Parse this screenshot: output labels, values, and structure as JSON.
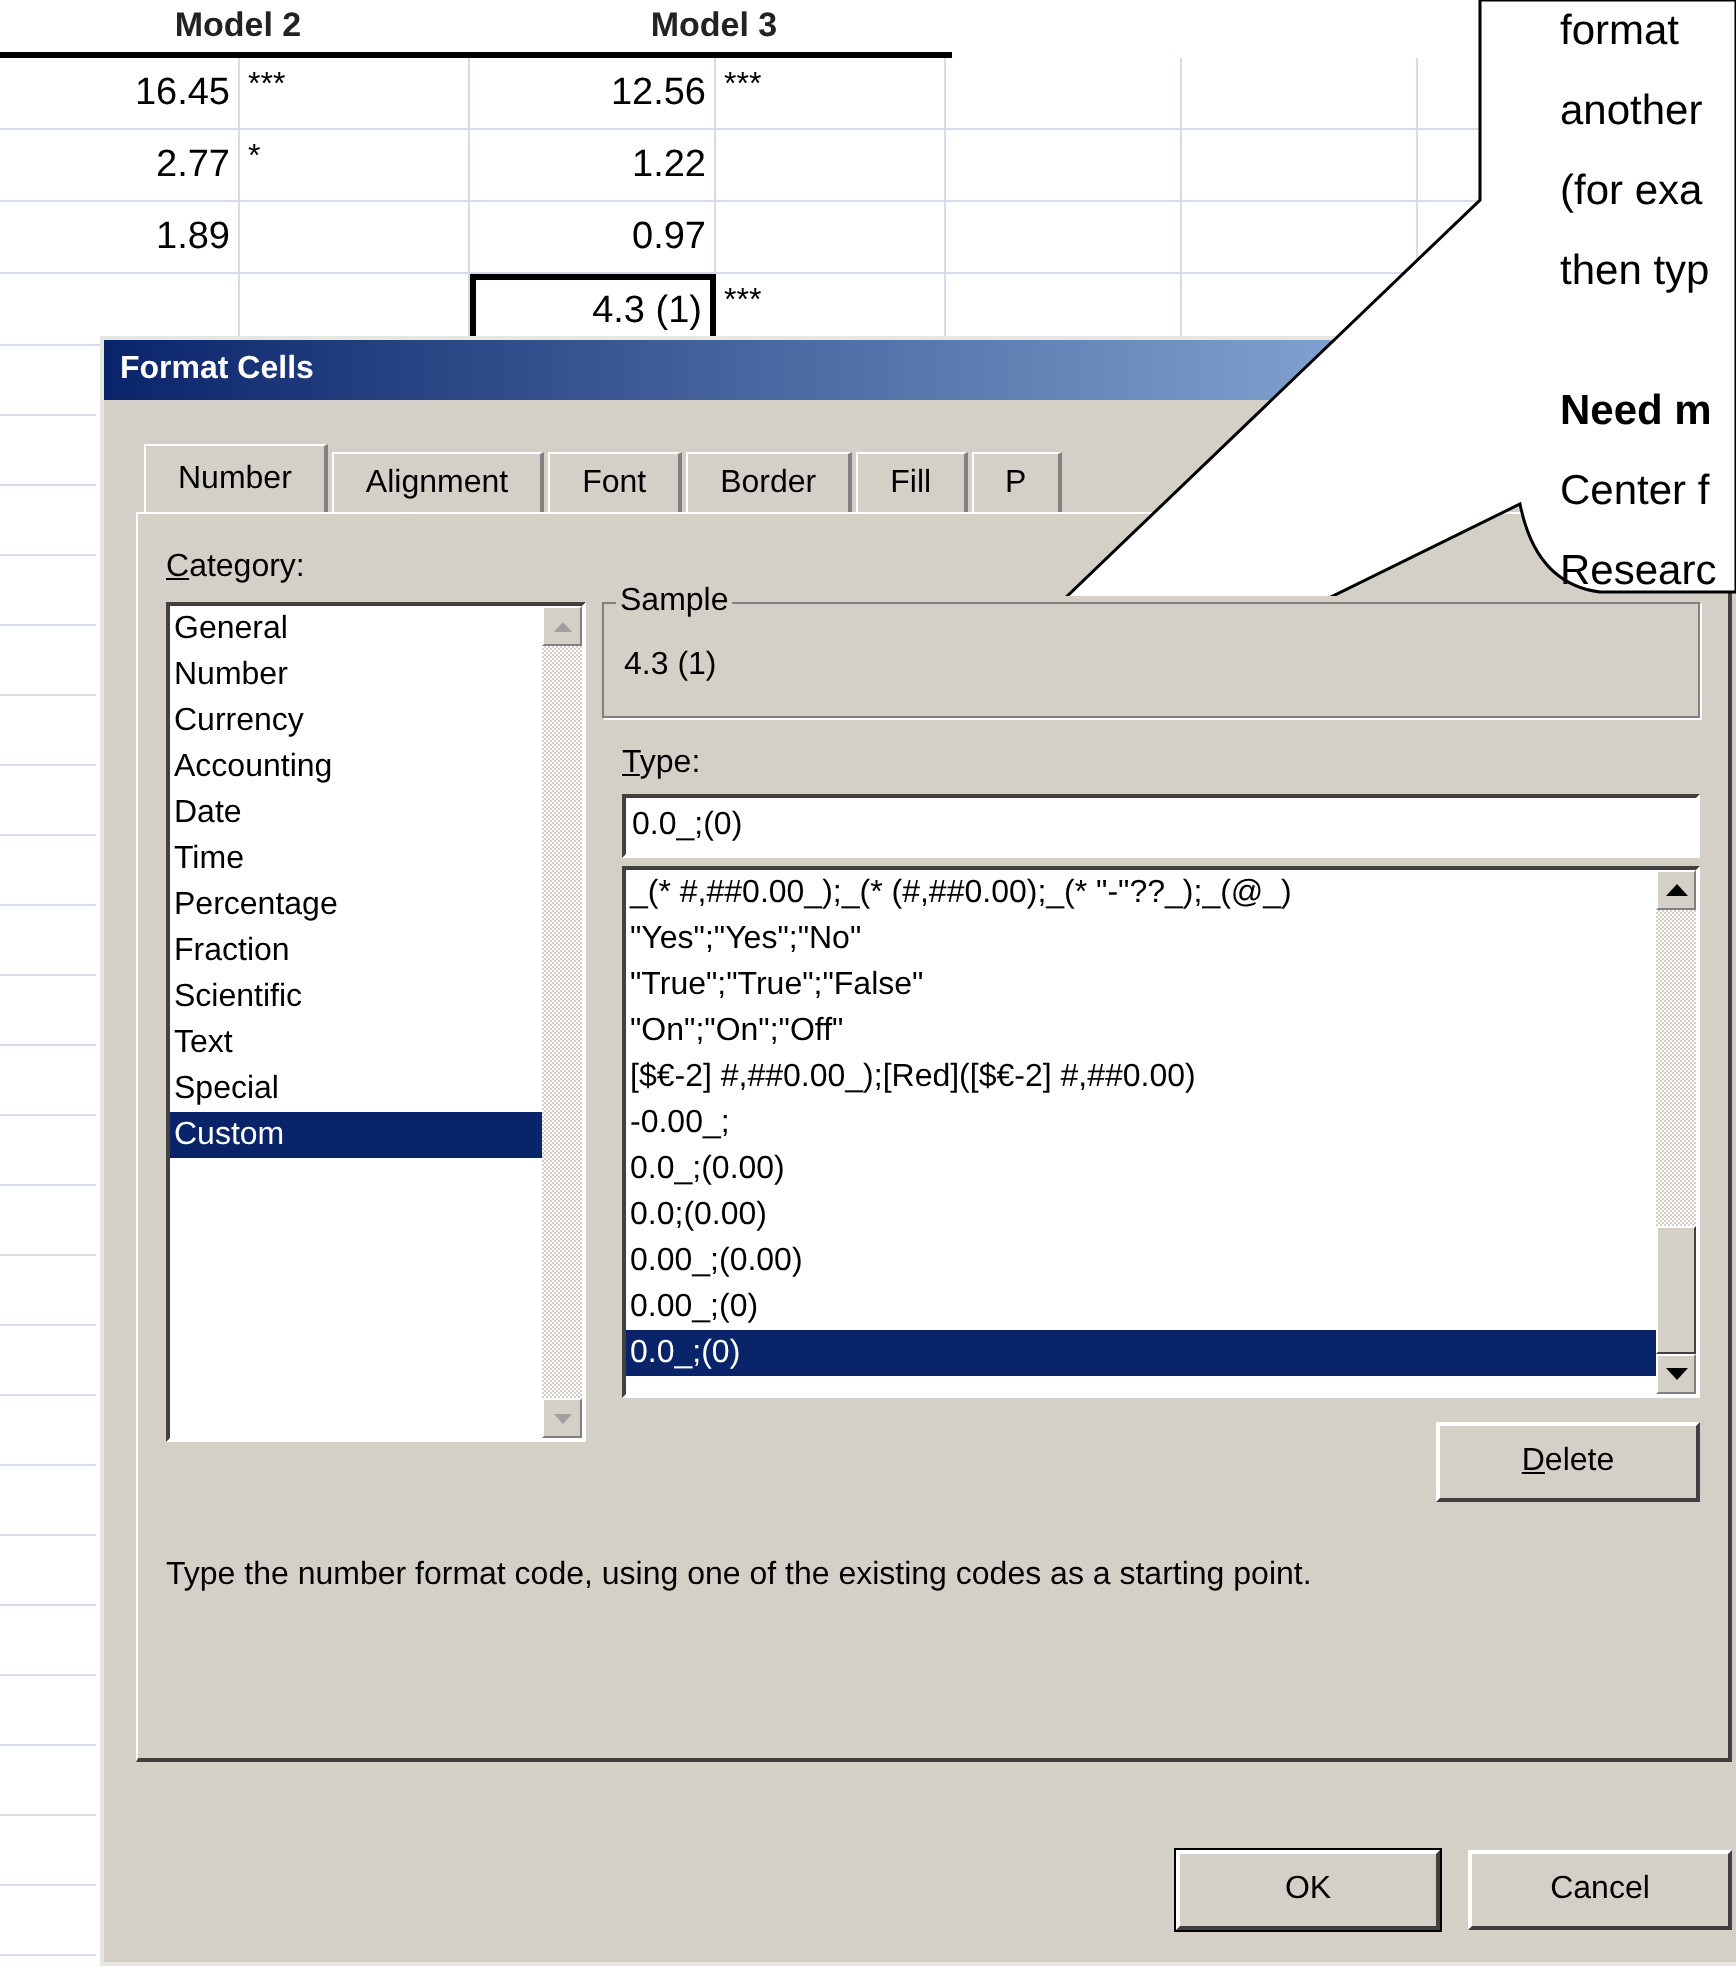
{
  "sheet": {
    "headers": [
      "Model 2",
      "Model 3"
    ],
    "rows": [
      {
        "cells": [
          {
            "text": "16.45",
            "selected": false
          },
          {
            "text": "***",
            "selected": false
          },
          {
            "text": "12.56",
            "selected": false
          },
          {
            "text": "***",
            "selected": false
          }
        ]
      },
      {
        "cells": [
          {
            "text": "2.77",
            "selected": false
          },
          {
            "text": "*",
            "selected": false
          },
          {
            "text": "1.22",
            "selected": false
          },
          {
            "selected": false
          }
        ]
      },
      {
        "cells": [
          {
            "text": "1.89",
            "selected": false
          },
          {
            "selected": false
          },
          {
            "text": "0.97",
            "selected": false
          },
          {
            "selected": false
          }
        ]
      },
      {
        "cells": [
          {
            "selected": false
          },
          {
            "selected": false
          },
          {
            "text": "4.3 (1)",
            "selected": true
          },
          {
            "text": "***",
            "selected": false
          }
        ]
      }
    ]
  },
  "dialog": {
    "title": "Format Cells",
    "tabs": [
      {
        "label": "Number",
        "selected": true
      },
      {
        "label": "Alignment",
        "selected": false
      },
      {
        "label": "Font",
        "selected": false
      },
      {
        "label": "Border",
        "selected": false
      },
      {
        "label": "Fill",
        "selected": false
      },
      {
        "label": "P",
        "selected": false
      }
    ],
    "category_label": "Category:",
    "categories": [
      {
        "label": "General",
        "selected": false
      },
      {
        "label": "Number",
        "selected": false
      },
      {
        "label": "Currency",
        "selected": false
      },
      {
        "label": "Accounting",
        "selected": false
      },
      {
        "label": "Date",
        "selected": false
      },
      {
        "label": "Time",
        "selected": false
      },
      {
        "label": "Percentage",
        "selected": false
      },
      {
        "label": "Fraction",
        "selected": false
      },
      {
        "label": "Scientific",
        "selected": false
      },
      {
        "label": "Text",
        "selected": false
      },
      {
        "label": "Special",
        "selected": false
      },
      {
        "label": "Custom",
        "selected": true
      }
    ],
    "sample": {
      "label": "Sample",
      "value": "4.3 (1)"
    },
    "type_label": "Type:",
    "type_value": "0.0_;(0)",
    "formats": [
      {
        "label": "_(* #,##0.00_);_(* (#,##0.00);_(* \"-\"??_);_(@_)",
        "selected": false
      },
      {
        "label": "\"Yes\";\"Yes\";\"No\"",
        "selected": false
      },
      {
        "label": "\"True\";\"True\";\"False\"",
        "selected": false
      },
      {
        "label": "\"On\";\"On\";\"Off\"",
        "selected": false
      },
      {
        "label": "[$€-2] #,##0.00_);[Red]([$€-2] #,##0.00)",
        "selected": false
      },
      {
        "label": "-0.00_;",
        "selected": false
      },
      {
        "label": "0.0_;(0.00)",
        "selected": false
      },
      {
        "label": "0.0;(0.00)",
        "selected": false
      },
      {
        "label": "0.00_;(0.00)",
        "selected": false
      },
      {
        "label": "0.00_;(0)",
        "selected": false
      },
      {
        "label": "0.0_;(0)",
        "selected": true
      }
    ],
    "delete_button": "Delete",
    "description": "Type the number format code, using one of the existing codes as a starting point.",
    "buttons": [
      "OK",
      "Cancel"
    ]
  },
  "callout": {
    "lines": [
      {
        "text": "format",
        "bold": false
      },
      {
        "text": "another",
        "bold": false
      },
      {
        "text": "(for exa",
        "bold": false
      },
      {
        "text": "then typ",
        "bold": false
      },
      {
        "text": "Need m",
        "bold": true
      },
      {
        "text": "Center f",
        "bold": false
      },
      {
        "text": "Researc",
        "bold": false
      }
    ]
  }
}
